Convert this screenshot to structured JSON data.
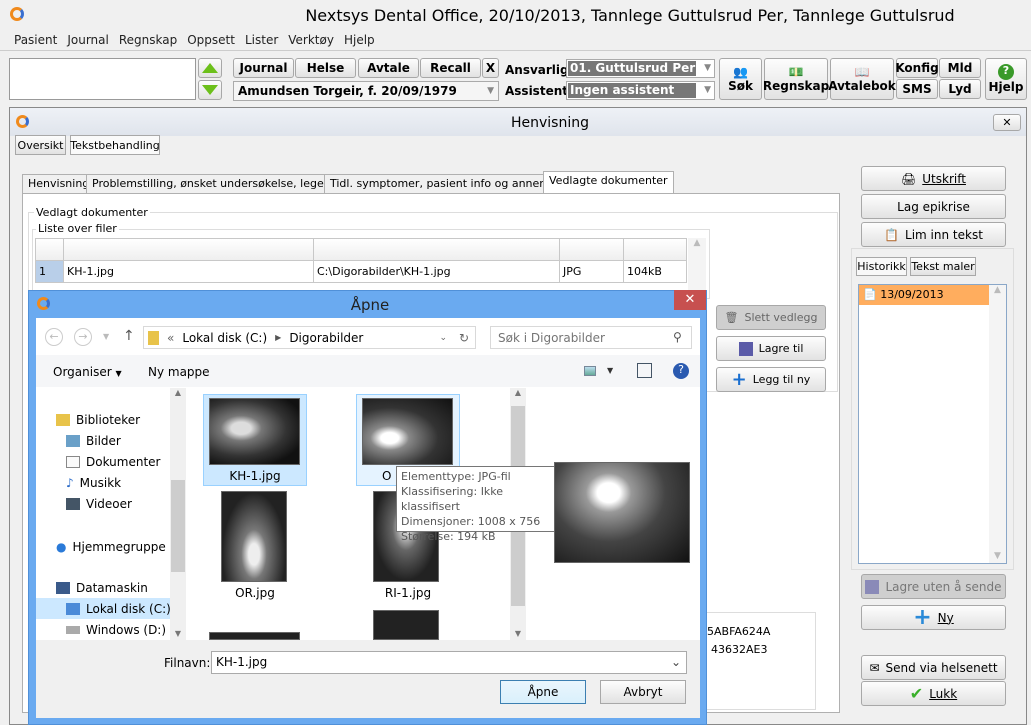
{
  "app": {
    "title": "Nextsys Dental Office,  20/10/2013, Tannlege Guttulsrud Per,  Tannlege Guttulsrud"
  },
  "menu": [
    "Pasient",
    "Journal",
    "Regnskap",
    "Oppsett",
    "Lister",
    "Verktøy",
    "Hjelp"
  ],
  "toolbar": {
    "journal": "Journal",
    "helse": "Helse",
    "avtale": "Avtale",
    "recall": "Recall",
    "close": "X",
    "patient": "Amundsen Torgeir, f. 20/09/1979",
    "ansvarlig_label": "Ansvarlig:",
    "ansvarlig_value": "01. Guttulsrud Per",
    "assistent_label": "Assistent:",
    "assistent_value": "Ingen assistent",
    "sok": "Søk",
    "regnskap": "Regnskap",
    "avtalebok": "Avtalebok",
    "konfig": "Konfig",
    "mld": "Mld",
    "sms": "SMS",
    "lyd": "Lyd",
    "hjelp": "Hjelp"
  },
  "window": {
    "title": "Henvisning",
    "view_buttons": [
      "Oversikt",
      "Tekstbehandling"
    ],
    "tabs": [
      "Henvisning",
      "Problemstilling, ønsket undersøkelse, legemidler",
      "Tidl. symptomer, pasient info og annen info",
      "Vedlagte dokumenter"
    ],
    "group_label": "Vedlagt dokumenter",
    "list_label": "Liste over filer",
    "rows": [
      {
        "n": "1",
        "name": "KH-1.jpg",
        "path": "C:\\Digorabilder\\KH-1.jpg",
        "type": "JPG",
        "size": "104kB"
      }
    ],
    "slett": "Slett vedlegg",
    "lagre_til": "Lagre til",
    "legg_til": "Legg til ny",
    "hash1": "5ABFA624A",
    "hash2": "43632AE3",
    "right": {
      "utskrift": "Utskrift",
      "epikrise": "Lag epikrise",
      "lim_inn": "Lim inn tekst",
      "tabs": [
        "Historikk",
        "Tekst maler"
      ],
      "history": [
        "13/09/2013"
      ],
      "lagre_uten": "Lagre uten å sende",
      "ny": "Ny",
      "send": "Send via helsenett",
      "lukk": "Lukk"
    }
  },
  "dialog": {
    "title": "Åpne",
    "breadcrumb": [
      "Lokal disk (C:)",
      "Digorabilder"
    ],
    "search_placeholder": "Søk i Digorabilder",
    "organiser": "Organiser",
    "ny_mappe": "Ny mappe",
    "nav": [
      {
        "label": "Biblioteker"
      },
      {
        "label": "Bilder"
      },
      {
        "label": "Dokumenter"
      },
      {
        "label": "Musikk"
      },
      {
        "label": "Videoer"
      },
      {
        "label": "Hjemmegruppe"
      },
      {
        "label": "Datamaskin"
      },
      {
        "label": "Lokal disk (C:)"
      },
      {
        "label": "Windows (D:)"
      }
    ],
    "files": [
      "KH-1.jpg",
      "O",
      "OR.jpg",
      "RI-1.jpg"
    ],
    "tooltip": [
      "Elementtype: JPG-fil",
      "Klassifisering: Ikke klassifisert",
      "Dimensjoner: 1008 x 756",
      "Størrelse: 194 kB"
    ],
    "filename_label": "Filnavn:",
    "filename_value": "KH-1.jpg",
    "open": "Åpne",
    "cancel": "Avbryt"
  },
  "colors": {
    "dialog_title": "#6aaaf0",
    "close_red": "#c7504f",
    "history_sel": "#ffad5e",
    "selection": "#cce8ff"
  }
}
